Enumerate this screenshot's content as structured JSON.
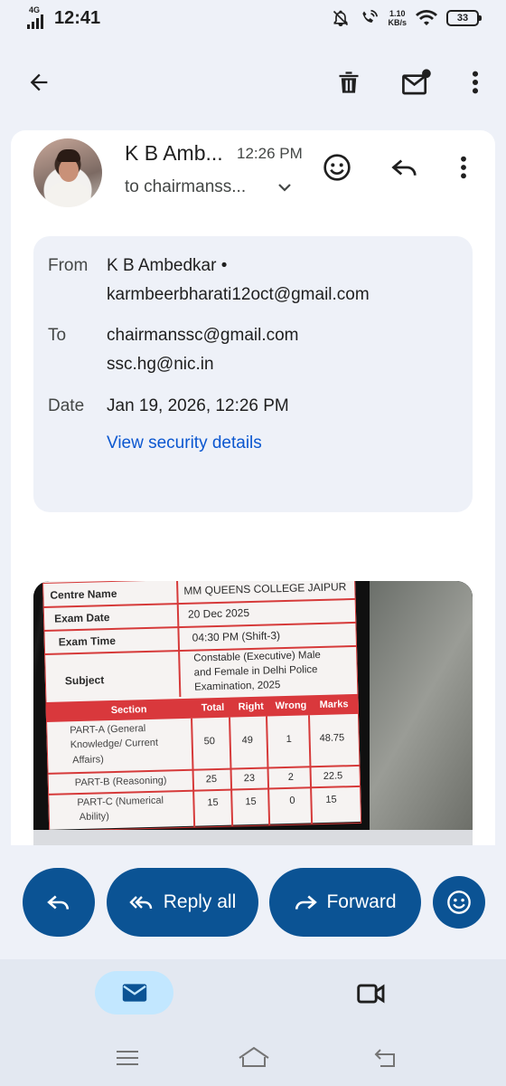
{
  "status_bar": {
    "network": "4G",
    "time": "12:41",
    "speed_value": "1.10",
    "speed_unit": "KB/s",
    "battery": "33"
  },
  "toolbar": {
    "back_icon": "arrow-back-icon",
    "delete_icon": "trash-icon",
    "unread_icon": "mark-unread-icon",
    "more_icon": "more-vert-icon"
  },
  "message": {
    "sender_short": "K B Amb...",
    "time": "12:26 PM",
    "to_short": "to chairmanss...",
    "details": {
      "from_label": "From",
      "from_name": "K B Ambedkar •",
      "from_email": "karmbeerbharati12oct@gmail.com",
      "to_label": "To",
      "to_1": "chairmanssc@gmail.com",
      "to_2": "ssc.hg@nic.in",
      "date_label": "Date",
      "date_value": "Jan 19, 2026, 12:26 PM",
      "security_link": "View security details"
    }
  },
  "attachment": {
    "rows": [
      {
        "label": "Centre Name",
        "value": "MM QUEENS COLLEGE JAIPUR"
      },
      {
        "label": "Exam Date",
        "value": "20 Dec 2025"
      },
      {
        "label": "Exam Time",
        "value": "04:30 PM (Shift-3)"
      },
      {
        "label": "Subject",
        "value_lines": [
          "Constable (Executive) Male",
          "and Female in Delhi Police",
          "Examination, 2025"
        ]
      }
    ],
    "table_headers": [
      "Section",
      "Total",
      "Right",
      "Wrong",
      "Marks"
    ],
    "sections": [
      {
        "name_lines": [
          "PART-A (General",
          "Knowledge/ Current",
          "Affairs)"
        ],
        "total": "50",
        "right": "49",
        "wrong": "1",
        "marks": "48.75"
      },
      {
        "name_lines": [
          "PART-B (Reasoning)"
        ],
        "total": "25",
        "right": "23",
        "wrong": "2",
        "marks": "22.5"
      },
      {
        "name_lines": [
          "PART-C (Numerical",
          "Ability)"
        ],
        "total": "15",
        "right": "15",
        "wrong": "0",
        "marks": "15"
      }
    ]
  },
  "actions": {
    "reply_all_label": "Reply all",
    "forward_label": "Forward"
  },
  "colors": {
    "accent": "#0b5394",
    "link": "#0b57d0",
    "nav_active": "#c2e7ff"
  }
}
